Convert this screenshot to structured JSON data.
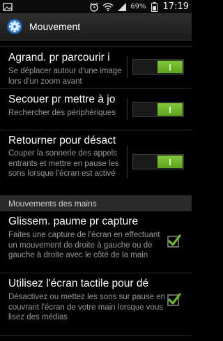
{
  "status": {
    "battery_percent": "69%",
    "time": "17:19",
    "left_icon": "image-notification-icon",
    "icons": [
      "alarm-icon",
      "wifi-icon",
      "signal-icon",
      "battery-icon"
    ]
  },
  "header": {
    "title": "Mouvement",
    "icon": "gear-icon"
  },
  "rows": [
    {
      "title": "Agrand. pr parcourir i",
      "summary": "Se déplacer autour d'une image lors d'un zoom avant",
      "control": "toggle",
      "state": "I"
    },
    {
      "title": "Secouer pr mettre à jo",
      "summary": "Rechercher des périphériques",
      "control": "toggle",
      "state": "I"
    },
    {
      "title": "Retourner pour désact",
      "summary": "Couper la sonnerie des appels entrants et mettre en pause les sons lorsque l'écran est activé",
      "control": "toggle",
      "state": "I"
    }
  ],
  "section": {
    "label": "Mouvements des mains"
  },
  "hand_rows": [
    {
      "title": "Glissem. paume pr capture",
      "summary": "Faites une capture de l'écran en effectuant un mouvement de droite à gauche ou de gauche à droite avec le côté de la main",
      "checked": true
    },
    {
      "title": "Utilisez l'écran tactile pour dé",
      "summary": "Désactivez ou mettez les sons sur pause en couvrant l'écran de votre main lorsque vous lisez des médias",
      "checked": true
    }
  ],
  "colors": {
    "accent": "#6cb82b",
    "background": "#000000",
    "summary_text": "#9a9a9a"
  }
}
